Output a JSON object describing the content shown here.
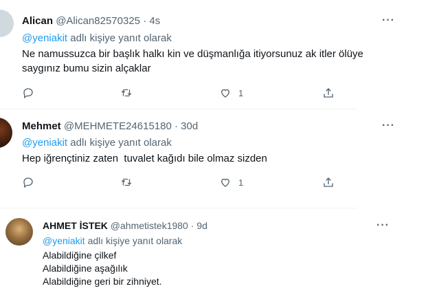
{
  "tweets": [
    {
      "name": "Alican",
      "handle": "@Alican82570325",
      "time": "4s",
      "reply_prefix": "@yeniakit",
      "reply_suffix": "adlı kişiye yanıt olarak",
      "body": "Ne namussuzca bir başlık halkı kin ve düşmanlığa itiyorsunuz ak itler ölüye\nsaygınız bumu sizin alçaklar",
      "likes": "1"
    },
    {
      "name": "Mehmet",
      "handle": "@MEHMETE24615180",
      "time": "30d",
      "reply_prefix": "@yeniakit",
      "reply_suffix": "adlı kişiye yanıt olarak",
      "body": "Hep iğrençtiniz zaten  tuvalet kağıdı bile olmaz sizden",
      "likes": "1"
    },
    {
      "name": "AHMET İSTEK",
      "handle": "@ahmetistek1980",
      "time": "9d",
      "reply_prefix": "@yeniakit",
      "reply_suffix": "adlı kişiye yanıt olarak",
      "body": "Alabildiğine çilkef\nAlabildiğine aşağılık\nAlabildiğine geri bir zihniyet."
    }
  ],
  "separator": "·",
  "more_label": "···",
  "colors": {
    "accent": "#1d9bf0",
    "muted": "#536471",
    "text": "#0f1419"
  }
}
